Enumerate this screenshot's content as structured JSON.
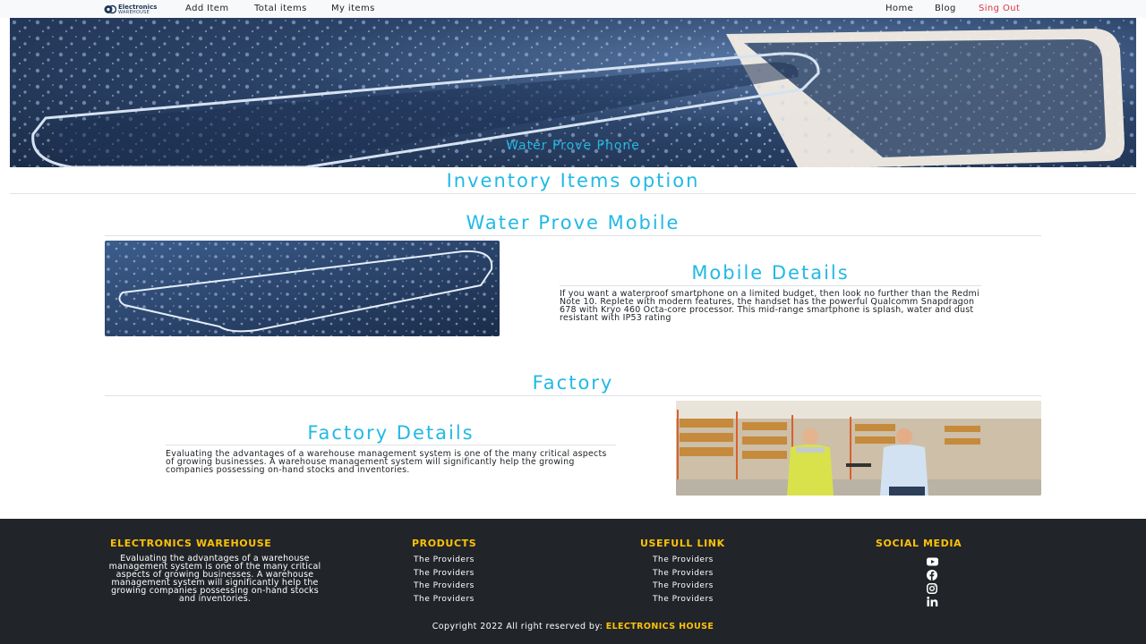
{
  "nav": {
    "logo_line1": "Electronics",
    "logo_line2": "WAREHOUSE",
    "add_item": "Add Item",
    "total_items": "Total items",
    "my_items": "My items",
    "home": "Home",
    "blog": "Blog",
    "sign_out": "Sing Out"
  },
  "hero": {
    "caption": "Water Prove Phone"
  },
  "inventory": {
    "heading": "Inventory Items option"
  },
  "mobile": {
    "heading": "Water Prove Mobile",
    "details_heading": "Mobile Details",
    "details_text": "If you want a waterproof smartphone on a limited budget, then look no further than the Redmi Note 10. Replete with modern features, the handset has the powerful Qualcomm Snapdragon 678 with Kryo 460 Octa-core processor. This mid-range smartphone is splash, water and dust resistant with IP53 rating"
  },
  "factory": {
    "heading": "Factory",
    "details_heading": "Factory Details",
    "details_text": "Evaluating the advantages of a warehouse management system is one of the many critical aspects of growing businesses. A warehouse management system will significantly help the growing companies possessing on-hand stocks and inventories."
  },
  "footer": {
    "brand_heading": "ELECTRONICS WAREHOUSE",
    "brand_text": "Evaluating the advantages of a warehouse management system is one of the many critical aspects of growing businesses. A warehouse management system will significantly help the growing companies possessing on-hand stocks and inventories.",
    "products_heading": "PRODUCTS",
    "products": [
      "The Providers",
      "The Providers",
      "The Providers",
      "The Providers"
    ],
    "links_heading": "USEFULL LINK",
    "links": [
      "The Providers",
      "The Providers",
      "The Providers",
      "The Providers"
    ],
    "social_heading": "SOCIAL MEDIA",
    "social_icons": [
      "youtube-icon",
      "facebook-icon",
      "instagram-icon",
      "linkedin-icon"
    ],
    "copyright_prefix": "Copyright 2022 All right reserved by:",
    "copyright_brand": "ELECTRONICS HOUSE"
  },
  "colors": {
    "accent": "#21b9e5",
    "footer_bg": "#212529",
    "footer_heading": "#ffc107",
    "signout": "#dc3545"
  }
}
